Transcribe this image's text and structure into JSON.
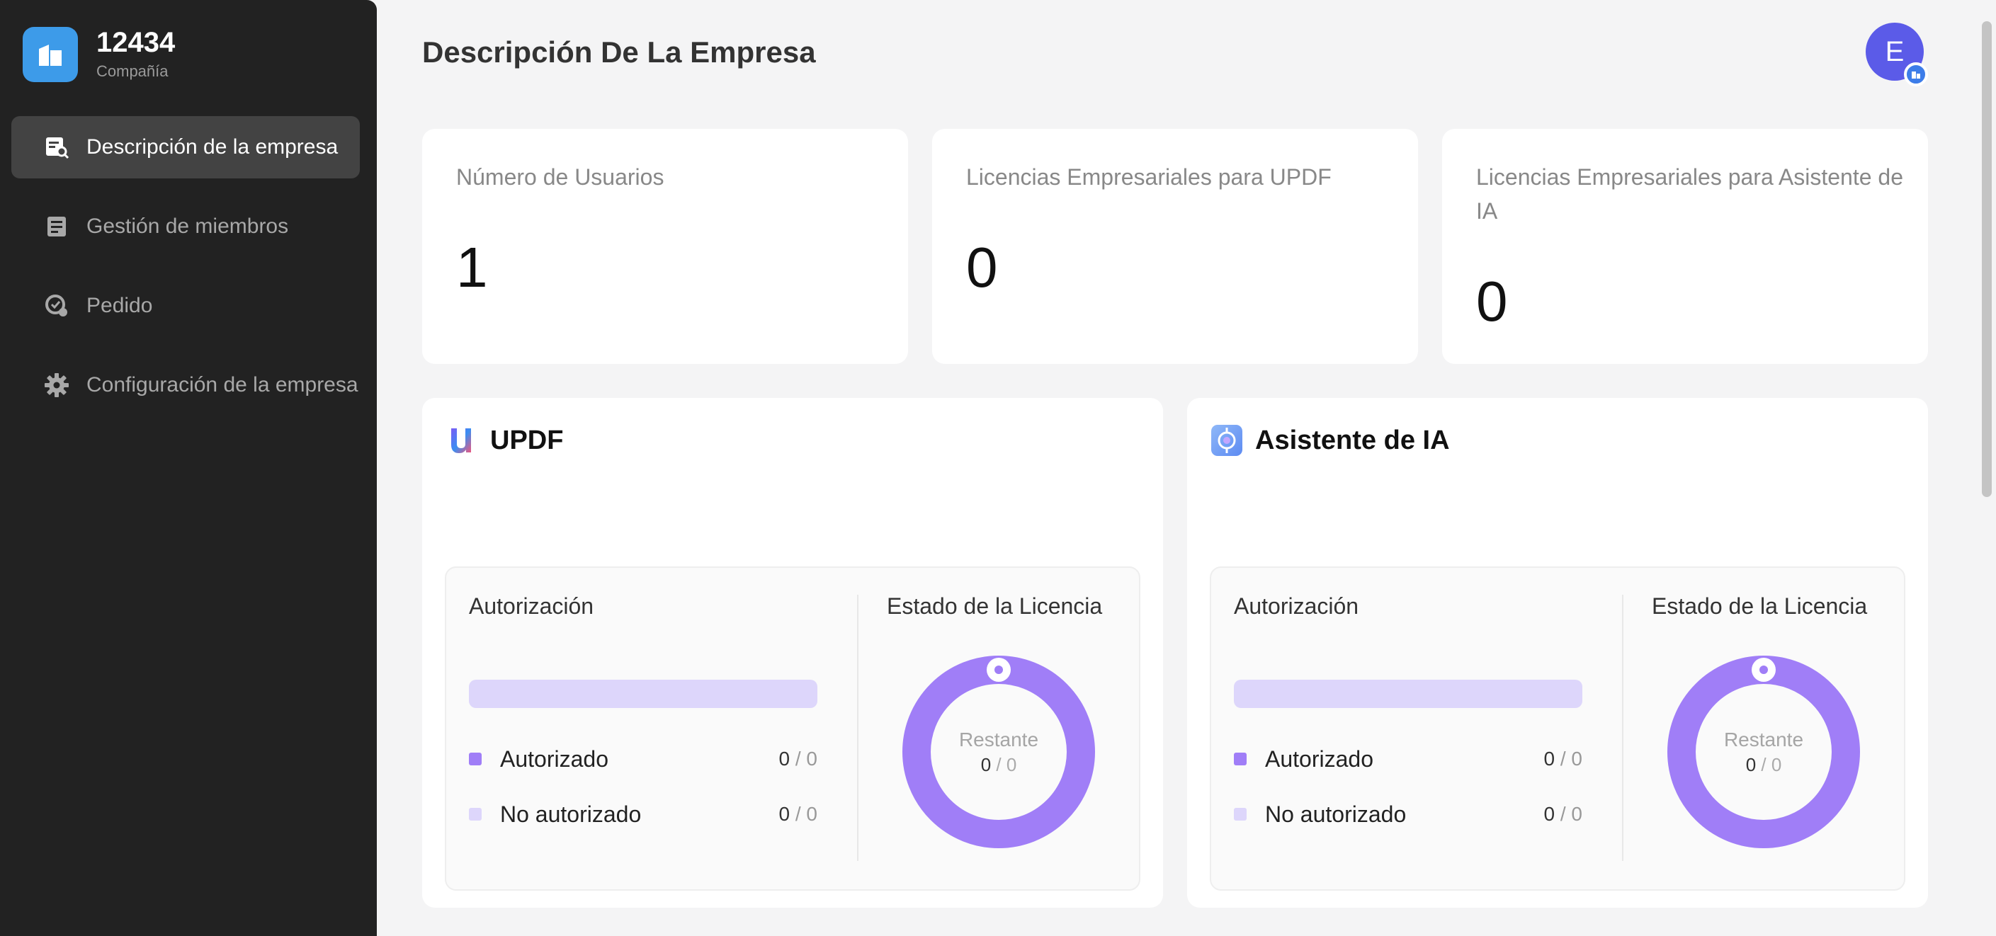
{
  "brand": {
    "name": "12434",
    "subtitle": "Compañía"
  },
  "sidebar": {
    "items": [
      {
        "label": "Descripción de la empresa",
        "icon": "company-overview-icon",
        "active": true
      },
      {
        "label": "Gestión de miembros",
        "icon": "members-list-icon",
        "active": false
      },
      {
        "label": "Pedido",
        "icon": "order-icon",
        "active": false
      },
      {
        "label": "Configuración de la empresa",
        "icon": "gear-icon",
        "active": false
      }
    ]
  },
  "header": {
    "title": "Descripción De La Empresa",
    "avatar_initial": "E"
  },
  "stats": [
    {
      "label": "Número de Usuarios",
      "value": "1"
    },
    {
      "label": "Licencias Empresariales para UPDF",
      "value": "0"
    },
    {
      "label": "Licencias Empresariales para Asistente de IA",
      "value": "0"
    }
  ],
  "panels": [
    {
      "title": "UPDF",
      "icon": "updf-logo-icon",
      "auth_title": "Autorización",
      "authorized": {
        "label": "Autorizado",
        "used": "0",
        "total": "0"
      },
      "unauthorized": {
        "label": "No autorizado",
        "used": "0",
        "total": "0"
      },
      "license_title": "Estado de la Licencia",
      "remaining": {
        "label": "Restante",
        "used": "0",
        "total": "0"
      }
    },
    {
      "title": "Asistente de IA",
      "icon": "ai-assistant-logo-icon",
      "auth_title": "Autorización",
      "authorized": {
        "label": "Autorizado",
        "used": "0",
        "total": "0"
      },
      "unauthorized": {
        "label": "No autorizado",
        "used": "0",
        "total": "0"
      },
      "license_title": "Estado de la Licencia",
      "remaining": {
        "label": "Restante",
        "used": "0",
        "total": "0"
      }
    }
  ],
  "colors": {
    "sidebar_bg": "#222222",
    "accent_purple": "#a07ef7",
    "light_purple": "#ddd6fb",
    "avatar_blue": "#5b5be8",
    "brand_blue": "#3d9be9"
  }
}
